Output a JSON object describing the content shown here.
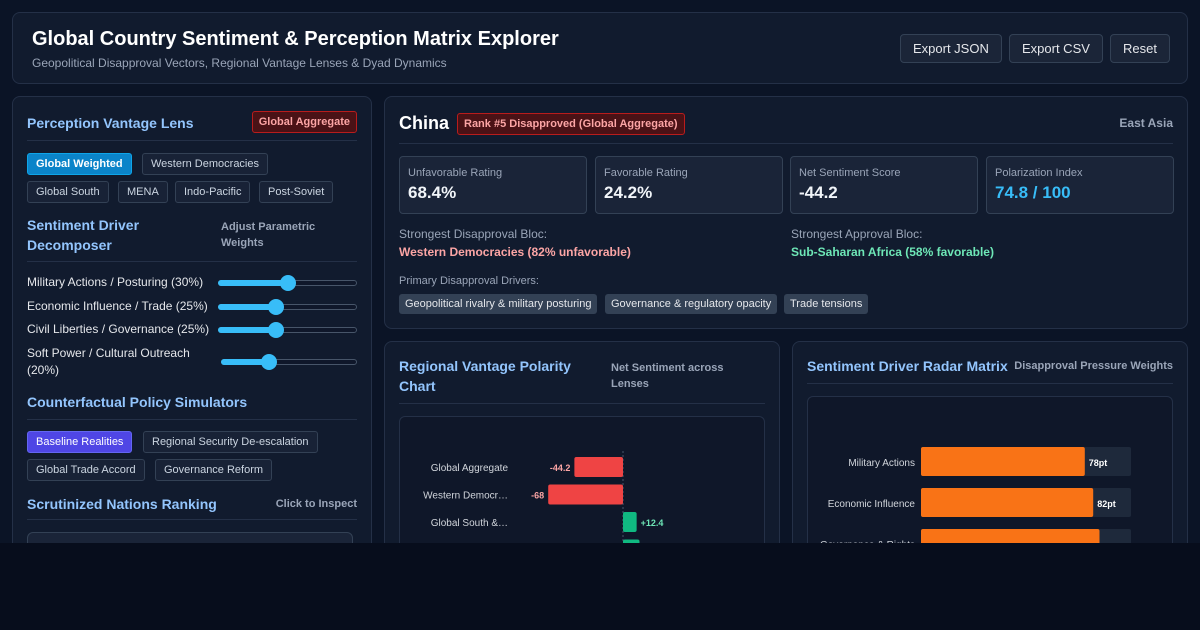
{
  "header": {
    "title": "Global Country Sentiment & Perception Matrix Explorer",
    "subtitle": "Geopolitical Disapproval Vectors, Regional Vantage Lenses & Dyad Dynamics",
    "buttons": {
      "export_json": "Export JSON",
      "export_csv": "Export CSV",
      "reset": "Reset"
    }
  },
  "vantage": {
    "title": "Perception Vantage Lens",
    "badge": "Global Aggregate",
    "lenses": [
      "Global Weighted",
      "Western Democracies",
      "Global South",
      "MENA",
      "Indo-Pacific",
      "Post-Soviet"
    ],
    "active_lens": "Global Weighted"
  },
  "drivers": {
    "title": "Sentiment Driver Decomposer",
    "note": "Adjust Parametric Weights",
    "sliders": [
      {
        "label": "Military Actions / Posturing (30%)",
        "value": 0.5
      },
      {
        "label": "Economic Influence / Trade (25%)",
        "value": 0.42
      },
      {
        "label": "Civil Liberties / Governance (25%)",
        "value": 0.42
      },
      {
        "label": "Soft Power / Cultural Outreach (20%)",
        "value": 0.35
      }
    ]
  },
  "counterfactual": {
    "title": "Counterfactual Policy Simulators",
    "options": [
      "Baseline Realities",
      "Regional Security De-escalation",
      "Global Trade Accord",
      "Governance Reform"
    ],
    "active_option": "Baseline Realities"
  },
  "ranking": {
    "title": "Scrutinized Nations Ranking",
    "note": "Click to Inspect"
  },
  "country": {
    "name": "China",
    "rank_badge": "Rank #5 Disapproved (Global Aggregate)",
    "region": "East Asia",
    "metrics": [
      {
        "label": "Unfavorable Rating",
        "value": "68.4%"
      },
      {
        "label": "Favorable Rating",
        "value": "24.2%"
      },
      {
        "label": "Net Sentiment Score",
        "value": "-44.2"
      },
      {
        "label": "Polarization Index",
        "value": "74.8 / 100"
      }
    ],
    "disapproval_bloc_label": "Strongest Disapproval Bloc:",
    "disapproval_bloc": "Western Democracies (82% unfavorable)",
    "approval_bloc_label": "Strongest Approval Bloc:",
    "approval_bloc": "Sub-Saharan Africa (58% favorable)",
    "drivers_label": "Primary Disapproval Drivers:",
    "driver_tags": [
      "Geopolitical rivalry & military posturing",
      "Governance & regulatory opacity",
      "Trade tensions"
    ]
  },
  "polarity": {
    "title": "Regional Vantage Polarity Chart",
    "note": "Net Sentiment across Lenses"
  },
  "radar": {
    "title": "Sentiment Driver Radar Matrix",
    "note": "Disapproval Pressure Weights"
  },
  "colors": {
    "negative": "#ef4444",
    "positive": "#10b981",
    "pressure": "#f97316",
    "accent": "#93c5fd"
  },
  "chart_data": [
    {
      "type": "bar",
      "categories": [
        "Global Aggregate",
        "Western Democr…",
        "Global South &…",
        ""
      ],
      "values": [
        -44.2,
        -68,
        12.4,
        15
      ],
      "labels": [
        "-44.2",
        "-68",
        "+12.4",
        ""
      ]
    },
    {
      "type": "bar",
      "categories": [
        "Military Actions",
        "Economic Influence",
        "Governance & Rights"
      ],
      "values": [
        78,
        82,
        85
      ],
      "labels": [
        "78pt",
        "82pt",
        ""
      ],
      "ylim": [
        0,
        100
      ]
    }
  ]
}
